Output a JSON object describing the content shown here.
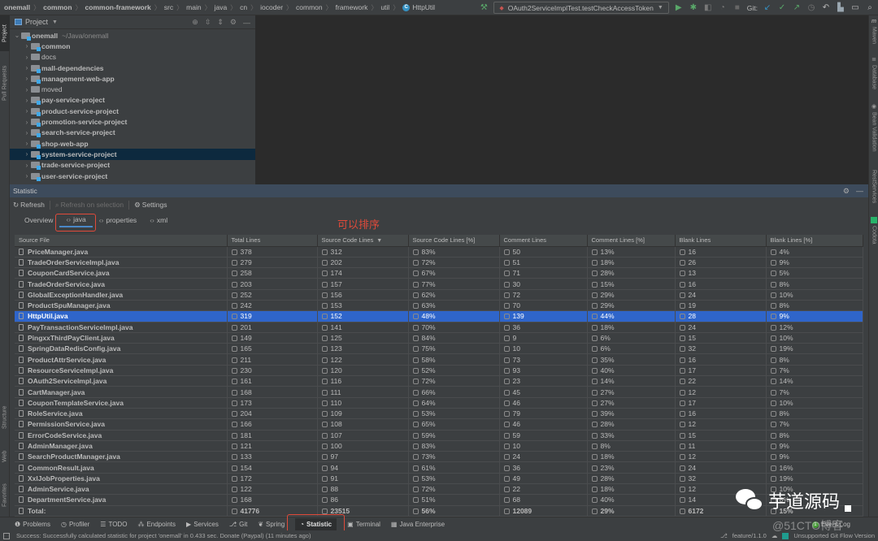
{
  "navbar": {
    "breadcrumbs": [
      "onemall",
      "common",
      "common-framework",
      "src",
      "main",
      "java",
      "cn",
      "iocoder",
      "common",
      "framework",
      "util",
      "HttpUtil"
    ],
    "run_config": "OAuth2ServiceImplTest.testCheckAccessToken",
    "git_label": "Git:"
  },
  "left_strip": {
    "tabs": [
      "Project",
      "Pull Requests",
      "Structure",
      "Web",
      "Favorites"
    ]
  },
  "right_strip": {
    "tabs": [
      "Maven",
      "Database",
      "Bean Validation",
      "RestServices",
      "Codota"
    ]
  },
  "project_panel": {
    "title": "Project",
    "root": {
      "name": "onemall",
      "path": "~/Java/onemall"
    },
    "items": [
      {
        "name": "common",
        "module": true,
        "bold": true
      },
      {
        "name": "docs",
        "module": false,
        "bold": false
      },
      {
        "name": "mall-dependencies",
        "module": true,
        "bold": true
      },
      {
        "name": "management-web-app",
        "module": true,
        "bold": true
      },
      {
        "name": "moved",
        "module": false,
        "bold": false
      },
      {
        "name": "pay-service-project",
        "module": true,
        "bold": true
      },
      {
        "name": "product-service-project",
        "module": true,
        "bold": true
      },
      {
        "name": "promotion-service-project",
        "module": true,
        "bold": true
      },
      {
        "name": "search-service-project",
        "module": true,
        "bold": true
      },
      {
        "name": "shop-web-app",
        "module": true,
        "bold": true
      },
      {
        "name": "system-service-project",
        "module": true,
        "bold": true,
        "selected": true
      },
      {
        "name": "trade-service-project",
        "module": true,
        "bold": true
      },
      {
        "name": "user-service-project",
        "module": true,
        "bold": true
      }
    ]
  },
  "statistic": {
    "title": "Statistic",
    "toolbar": {
      "refresh": "Refresh",
      "refresh_on_selection": "Refresh on selection",
      "settings": "Settings"
    },
    "tabs": [
      {
        "label": "Overview",
        "active": false,
        "code_icon": false
      },
      {
        "label": "java",
        "active": true,
        "code_icon": true
      },
      {
        "label": "properties",
        "active": false,
        "code_icon": true
      },
      {
        "label": "xml",
        "active": false,
        "code_icon": true
      }
    ],
    "annotation": "可以排序",
    "columns": [
      "Source File",
      "Total Lines",
      "Source Code Lines",
      "Source Code Lines [%]",
      "Comment Lines",
      "Comment Lines [%]",
      "Blank Lines",
      "Blank Lines [%]"
    ],
    "sorted_column": 2,
    "rows": [
      [
        "PriceManager.java",
        "378",
        "312",
        "83%",
        "50",
        "13%",
        "16",
        "4%"
      ],
      [
        "TradeOrderServiceImpl.java",
        "279",
        "202",
        "72%",
        "51",
        "18%",
        "26",
        "9%"
      ],
      [
        "CouponCardService.java",
        "258",
        "174",
        "67%",
        "71",
        "28%",
        "13",
        "5%"
      ],
      [
        "TradeOrderService.java",
        "203",
        "157",
        "77%",
        "30",
        "15%",
        "16",
        "8%"
      ],
      [
        "GlobalExceptionHandler.java",
        "252",
        "156",
        "62%",
        "72",
        "29%",
        "24",
        "10%"
      ],
      [
        "ProductSpuManager.java",
        "242",
        "153",
        "63%",
        "70",
        "29%",
        "19",
        "8%"
      ],
      [
        "HttpUtil.java",
        "319",
        "152",
        "48%",
        "139",
        "44%",
        "28",
        "9%"
      ],
      [
        "PayTransactionServiceImpl.java",
        "201",
        "141",
        "70%",
        "36",
        "18%",
        "24",
        "12%"
      ],
      [
        "PingxxThirdPayClient.java",
        "149",
        "125",
        "84%",
        "9",
        "6%",
        "15",
        "10%"
      ],
      [
        "SpringDataRedisConfig.java",
        "165",
        "123",
        "75%",
        "10",
        "6%",
        "32",
        "19%"
      ],
      [
        "ProductAttrService.java",
        "211",
        "122",
        "58%",
        "73",
        "35%",
        "16",
        "8%"
      ],
      [
        "ResourceServiceImpl.java",
        "230",
        "120",
        "52%",
        "93",
        "40%",
        "17",
        "7%"
      ],
      [
        "OAuth2ServiceImpl.java",
        "161",
        "116",
        "72%",
        "23",
        "14%",
        "22",
        "14%"
      ],
      [
        "CartManager.java",
        "168",
        "111",
        "66%",
        "45",
        "27%",
        "12",
        "7%"
      ],
      [
        "CouponTemplateService.java",
        "173",
        "110",
        "64%",
        "46",
        "27%",
        "17",
        "10%"
      ],
      [
        "RoleService.java",
        "204",
        "109",
        "53%",
        "79",
        "39%",
        "16",
        "8%"
      ],
      [
        "PermissionService.java",
        "166",
        "108",
        "65%",
        "46",
        "28%",
        "12",
        "7%"
      ],
      [
        "ErrorCodeService.java",
        "181",
        "107",
        "59%",
        "59",
        "33%",
        "15",
        "8%"
      ],
      [
        "AdminManager.java",
        "121",
        "100",
        "83%",
        "10",
        "8%",
        "11",
        "9%"
      ],
      [
        "SearchProductManager.java",
        "133",
        "97",
        "73%",
        "24",
        "18%",
        "12",
        "9%"
      ],
      [
        "CommonResult.java",
        "154",
        "94",
        "61%",
        "36",
        "23%",
        "24",
        "16%"
      ],
      [
        "XxlJobProperties.java",
        "172",
        "91",
        "53%",
        "49",
        "28%",
        "32",
        "19%"
      ],
      [
        "AdminService.java",
        "122",
        "88",
        "72%",
        "22",
        "18%",
        "12",
        "10%"
      ],
      [
        "DepartmentService.java",
        "168",
        "86",
        "51%",
        "68",
        "40%",
        "14",
        "8%"
      ]
    ],
    "selected_row": 6,
    "total": [
      "Total:",
      "41776",
      "23515",
      "56%",
      "12089",
      "29%",
      "6172",
      "15%"
    ]
  },
  "bottom_bar": {
    "items": [
      {
        "label": "Problems",
        "icon": "problems-icon",
        "glyph": "❶",
        "active": false
      },
      {
        "label": "Profiler",
        "icon": "profiler-icon",
        "glyph": "◷",
        "active": false
      },
      {
        "label": "TODO",
        "icon": "todo-icon",
        "glyph": "☰",
        "active": false
      },
      {
        "label": "Endpoints",
        "icon": "endpoints-icon",
        "glyph": "⁂",
        "active": false
      },
      {
        "label": "Services",
        "icon": "services-icon",
        "glyph": "▶",
        "active": false
      },
      {
        "label": "Git",
        "icon": "git-icon",
        "glyph": "⎇",
        "active": false
      },
      {
        "label": "Spring",
        "icon": "spring-icon",
        "glyph": "❦",
        "active": false
      },
      {
        "label": "Statistic",
        "icon": "statistic-icon",
        "glyph": "◔",
        "active": true
      },
      {
        "label": "Terminal",
        "icon": "terminal-icon",
        "glyph": "▣",
        "active": false
      },
      {
        "label": "Java Enterprise",
        "icon": "java-enterprise-icon",
        "glyph": "▦",
        "active": false
      }
    ],
    "event_log": {
      "count": "1",
      "label": "Event Log"
    }
  },
  "status_bar": {
    "message": "Success: Successfully calculated statistic for project 'onemall' in 0.433 sec. Donate (Paypal) (11 minutes ago)",
    "branch": "feature/1.1.0",
    "git_flow": "Unsupported Git Flow Version"
  },
  "watermark": {
    "text": "芋道源码",
    "site": "@51CTO博客"
  },
  "colors": {
    "accent": "#2f65ca",
    "annotation": "#e04a3a",
    "tree_selected": "#0d293e",
    "tab_underline": "#4a88c7"
  }
}
